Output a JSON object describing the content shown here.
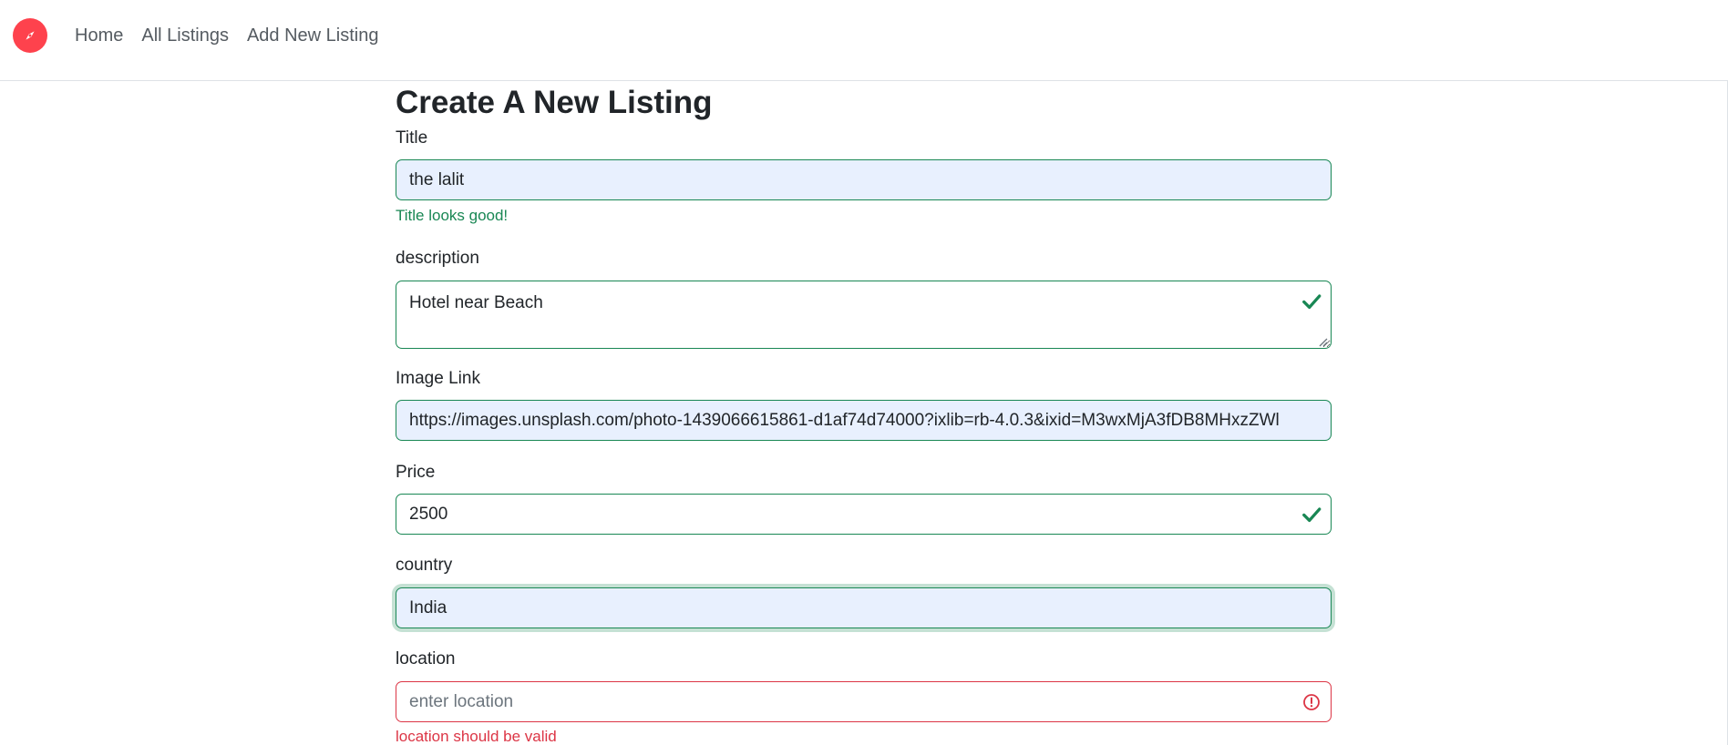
{
  "nav": {
    "brand_icon": "compass-icon",
    "brand_color": "#fe424d",
    "links": [
      "Home",
      "All Listings",
      "Add New Listing"
    ]
  },
  "page": {
    "title": "Create A New Listing"
  },
  "form": {
    "title": {
      "label": "Title",
      "value": "the lalit",
      "feedback": "Title looks good!"
    },
    "description": {
      "label": "description",
      "value": "Hotel near Beach",
      "status_icon": "check-icon"
    },
    "image": {
      "label": "Image Link",
      "value": "https://images.unsplash.com/photo-1439066615861-d1af74d74000?ixlib=rb-4.0.3&ixid=M3wxMjA3fDB8MHxzZWl"
    },
    "price": {
      "label": "Price",
      "value": "2500",
      "status_icon": "check-icon"
    },
    "country": {
      "label": "country",
      "value": "India"
    },
    "location": {
      "label": "location",
      "value": "",
      "placeholder": "enter location",
      "feedback": "location should be valid",
      "status_icon": "alert-circle-icon"
    }
  },
  "colors": {
    "valid": "#198754",
    "invalid": "#dc3545",
    "autofill_bg": "#e8f0fe"
  }
}
